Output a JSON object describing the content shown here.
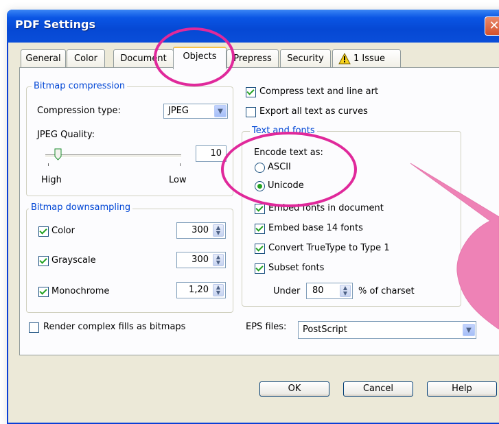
{
  "window": {
    "title": "PDF Settings",
    "close": "✕"
  },
  "tabs": [
    "General",
    "Color",
    "Document",
    "Objects",
    "Prepress",
    "Security",
    "1 Issue"
  ],
  "bitmap_compression": {
    "title": "Bitmap compression",
    "type_label": "Compression type:",
    "type_value": "JPEG",
    "quality_label": "JPEG Quality:",
    "quality_value": "10",
    "high": "High",
    "low": "Low"
  },
  "bitmap_downsampling": {
    "title": "Bitmap downsampling",
    "rows": [
      {
        "label": "Color",
        "value": "300"
      },
      {
        "label": "Grayscale",
        "value": "300"
      },
      {
        "label": "Monochrome",
        "value": "1,20"
      }
    ]
  },
  "render_complex": "Render complex fills as bitmaps",
  "compress_text": "Compress text and line art",
  "export_curves": "Export all text as curves",
  "text_fonts": {
    "title": "Text and fonts",
    "encode_label": "Encode text as:",
    "ascii": "ASCII",
    "unicode": "Unicode",
    "embed_fonts": "Embed fonts in document",
    "embed_base": "Embed base 14 fonts",
    "convert_tt": "Convert TrueType to Type 1",
    "subset": "Subset fonts",
    "under": "Under",
    "under_value": "80",
    "of_charset": "% of charset"
  },
  "eps": {
    "label": "EPS files:",
    "value": "PostScript"
  },
  "buttons": {
    "ok": "OK",
    "cancel": "Cancel",
    "help": "Help"
  },
  "icons": {
    "warning": "warning-icon",
    "dropdown": "chevron-down-icon",
    "spin": "spin-arrows-icon"
  },
  "colors": {
    "highlight": "#e0299b",
    "title_bar": "#0a55e4",
    "group_label": "#0046d5"
  }
}
